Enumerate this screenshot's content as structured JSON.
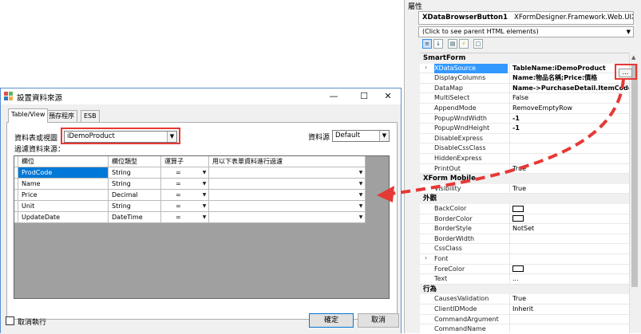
{
  "properties_panel": {
    "title": "屬性",
    "object_name": "XDataBrowserButton1",
    "object_type": "XFormDesigner.Framework.Web.UIXDataI",
    "parent_hint": "(Click to see parent HTML elements)",
    "rows": [
      {
        "kind": "category",
        "label": "SmartForm"
      },
      {
        "kind": "prop",
        "name": "XDataSource",
        "value": "TableName:iDemoProduct",
        "bold": true,
        "selected": true,
        "expandable": true
      },
      {
        "kind": "prop",
        "name": "DisplayColumns",
        "value": "Name:物品名稱;Price:價格",
        "bold": true
      },
      {
        "kind": "prop",
        "name": "DataMap",
        "value": "Name->PurchaseDetail.ItemCode;Pr",
        "bold": true
      },
      {
        "kind": "prop",
        "name": "MultiSelect",
        "value": "False"
      },
      {
        "kind": "prop",
        "name": "AppendMode",
        "value": "RemoveEmptyRow"
      },
      {
        "kind": "prop",
        "name": "PopupWndWidth",
        "value": "-1",
        "bold": true
      },
      {
        "kind": "prop",
        "name": "PopupWndHeight",
        "value": "-1",
        "bold": true
      },
      {
        "kind": "prop",
        "name": "DisableExpress",
        "value": ""
      },
      {
        "kind": "prop",
        "name": "DisableCssClass",
        "value": ""
      },
      {
        "kind": "prop",
        "name": "HiddenExpress",
        "value": ""
      },
      {
        "kind": "prop",
        "name": "PrintOut",
        "value": "True"
      },
      {
        "kind": "category",
        "label": "XForm Mobile"
      },
      {
        "kind": "prop",
        "name": "Visibility",
        "value": "True"
      },
      {
        "kind": "category",
        "label": "外觀"
      },
      {
        "kind": "prop",
        "name": "BackColor",
        "value": "",
        "swatch": true
      },
      {
        "kind": "prop",
        "name": "BorderColor",
        "value": "",
        "swatch": true
      },
      {
        "kind": "prop",
        "name": "BorderStyle",
        "value": "NotSet"
      },
      {
        "kind": "prop",
        "name": "BorderWidth",
        "value": ""
      },
      {
        "kind": "prop",
        "name": "CssClass",
        "value": ""
      },
      {
        "kind": "prop",
        "name": "Font",
        "value": "",
        "expandable": true
      },
      {
        "kind": "prop",
        "name": "ForeColor",
        "value": "",
        "swatch": true
      },
      {
        "kind": "prop",
        "name": "Text",
        "value": "..."
      },
      {
        "kind": "category",
        "label": "行為"
      },
      {
        "kind": "prop",
        "name": "CausesValidation",
        "value": "True"
      },
      {
        "kind": "prop",
        "name": "ClientIDMode",
        "value": "Inherit"
      },
      {
        "kind": "prop",
        "name": "CommandArgument",
        "value": ""
      },
      {
        "kind": "prop",
        "name": "CommandName",
        "value": ""
      }
    ],
    "ellipsis_label": "..."
  },
  "dialog": {
    "title": "設置資料來源",
    "tabs": [
      "Table/View",
      "預存程序",
      "ESB"
    ],
    "table_label": "資料表或視圖",
    "table_value": "iDemoProduct",
    "datasource_label": "資料源",
    "datasource_value": "Default",
    "filter_label": "過濾資料來源：",
    "grid_headers": [
      "欄位",
      "欄位類型",
      "運算子",
      "用以下表單資料進行過濾"
    ],
    "grid_rows": [
      {
        "field": "ProdCode",
        "type": "String",
        "op": "="
      },
      {
        "field": "Name",
        "type": "String",
        "op": "="
      },
      {
        "field": "Price",
        "type": "Decimal",
        "op": "="
      },
      {
        "field": "Unit",
        "type": "String",
        "op": "="
      },
      {
        "field": "UpdateDate",
        "type": "DateTime",
        "op": "="
      }
    ],
    "cancel_exec_label": "取消執行",
    "ok_label": "確定",
    "cancel_label": "取消"
  },
  "colors": {
    "highlight_red": "#e53935",
    "selection_blue": "#0078d7"
  }
}
